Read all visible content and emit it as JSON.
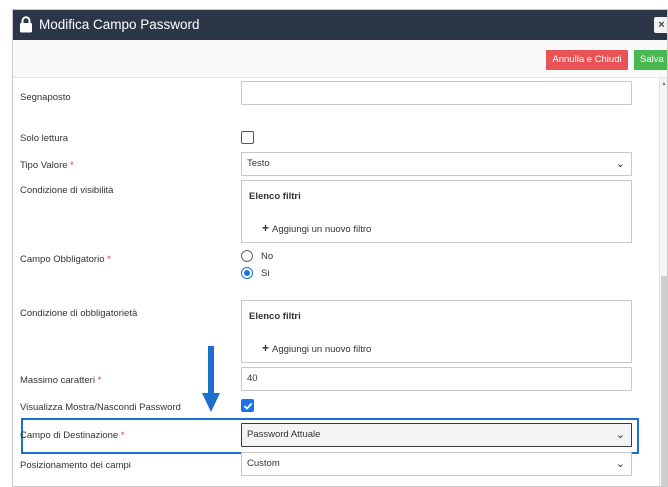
{
  "dialog": {
    "title": "Modifica Campo Password",
    "close_label": "×",
    "cancel_label": "Annulla e Chiudi",
    "save_label": "Salva"
  },
  "form": {
    "placeholder_label": "Segnaposto",
    "placeholder_value": "",
    "readonly_label": "Solo lettura",
    "value_type_label": "Tipo Valore",
    "value_type_selected": "Testo",
    "visibility_label": "Condizione di visibilità",
    "visibility_filter_title": "Elenco filtri",
    "visibility_add_filter": "Aggiungi un nuovo filtro",
    "mandatory_label": "Campo Obbligatorio",
    "mandatory_option_no": "No",
    "mandatory_option_yes": "Si",
    "mandatory_condition_label": "Condizione di obbligatorietà",
    "mandatory_filter_title": "Elenco filtri",
    "mandatory_add_filter": "Aggiungi un nuovo filtro",
    "max_chars_label": "Massimo caratteri",
    "max_chars_value": "40",
    "show_hide_label": "Visualizza Mostra/Nascondi Password",
    "destination_label": "Campo di Destinazione",
    "destination_selected": "Password Attuale",
    "positioning_label": "Posizionamento dei campi",
    "positioning_selected": "Custom",
    "required_mark": "*"
  },
  "colors": {
    "titlebar": "#2b3749",
    "cancel": "#ea5355",
    "save": "#49b851",
    "accent": "#1a73e8",
    "highlight": "#1d6fcf",
    "required": "#e33333"
  },
  "icons": [
    "lock-icon",
    "close-icon",
    "chevron-down-icon",
    "plus-icon",
    "check-icon",
    "down-arrow-annotation"
  ]
}
